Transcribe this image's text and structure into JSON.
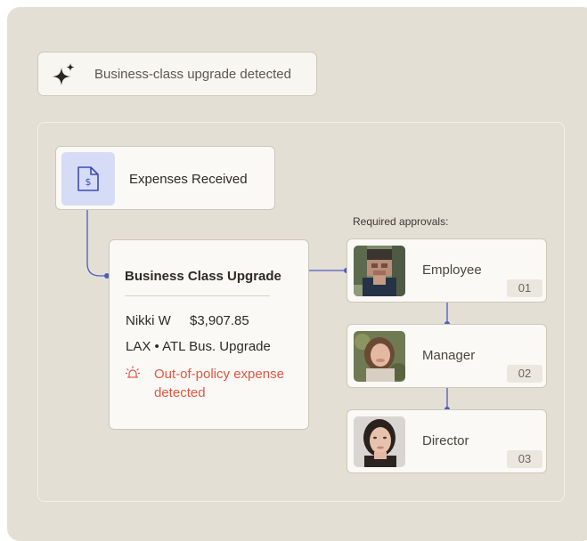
{
  "detection": {
    "icon": "sparkle-icon",
    "text": "Business-class upgrade detected"
  },
  "expenses": {
    "icon": "dollar-document-icon",
    "label": "Expenses Received"
  },
  "expense_detail": {
    "title": "Business Class Upgrade",
    "employee_name": "Nikki W",
    "amount": "$3,907.85",
    "route": "LAX • ATL Bus. Upgrade",
    "warning_icon": "alarm-light-icon",
    "warning_text": "Out-of-policy expense detected"
  },
  "approvals": {
    "heading": "Required approvals:",
    "steps": [
      {
        "role": "Employee",
        "step": "01",
        "avatar": "pixelated-photo"
      },
      {
        "role": "Manager",
        "step": "02",
        "avatar": "photo"
      },
      {
        "role": "Director",
        "step": "03",
        "avatar": "photo"
      }
    ]
  },
  "colors": {
    "background": "#e4dfd4",
    "card": "#faf9f6",
    "connector": "#4d5bc4",
    "warning": "#e2553f",
    "doc_tile": "#d6dcf5"
  }
}
